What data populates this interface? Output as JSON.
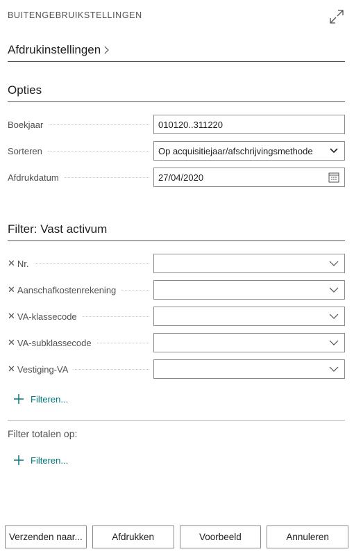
{
  "dialog": {
    "title": "BUITENGEBRUIKSTELLINGEN"
  },
  "print_settings": {
    "label": "Afdrukinstellingen"
  },
  "options": {
    "header": "Opties",
    "fields": [
      {
        "label": "Boekjaar",
        "value": "010120..311220"
      },
      {
        "label": "Sorteren",
        "value": "Op acquisitiejaar/afschrijvingsmethode"
      },
      {
        "label": "Afdrukdatum",
        "value": "27/04/2020"
      }
    ]
  },
  "filter": {
    "header": "Filter: Vast activum",
    "fields": [
      {
        "label": "Nr.",
        "value": ""
      },
      {
        "label": "Aanschafkostenrekening",
        "value": ""
      },
      {
        "label": "VA-klassecode",
        "value": ""
      },
      {
        "label": "VA-subklassecode",
        "value": ""
      },
      {
        "label": "Vestiging-VA",
        "value": ""
      }
    ],
    "add_label": "Filteren..."
  },
  "totals": {
    "label": "Filter totalen op:",
    "add_label": "Filteren..."
  },
  "footer": {
    "send_label": "Verzenden naar...",
    "print_label": "Afdrukken",
    "preview_label": "Voorbeeld",
    "cancel_label": "Annuleren"
  },
  "colors": {
    "accent": "#00797a",
    "text": "#212121",
    "muted": "#505050",
    "border": "#8a8a8a"
  },
  "icons": [
    "expand-icon",
    "chevron-right-icon",
    "chevron-down-icon",
    "calendar-icon",
    "remove-filter-icon",
    "plus-icon"
  ]
}
